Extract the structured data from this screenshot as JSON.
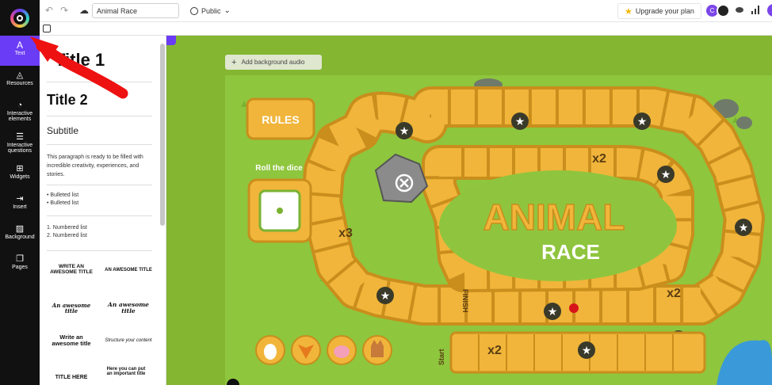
{
  "topbar": {
    "title_value": "Animal Race",
    "visibility": "Public",
    "upgrade_label": "Upgrade your plan",
    "avatar_initial": "C"
  },
  "sidebar": {
    "items": [
      {
        "label": "Text",
        "icon": "text-icon"
      },
      {
        "label": "Resources",
        "icon": "shapes-icon"
      },
      {
        "label": "Interactive elements",
        "icon": "cursor-icon"
      },
      {
        "label": "Interactive questions",
        "icon": "question-list-icon"
      },
      {
        "label": "Widgets",
        "icon": "widget-icon"
      },
      {
        "label": "Insert",
        "icon": "insert-icon"
      },
      {
        "label": "Background",
        "icon": "background-icon"
      },
      {
        "label": "Pages",
        "icon": "pages-icon"
      }
    ]
  },
  "text_panel": {
    "title1": "Title 1",
    "title2": "Title 2",
    "subtitle": "Subtitle",
    "paragraph": "This paragraph is ready to be filled with incredible creativity, experiences, and stories.",
    "bullets": [
      "Bulleted list",
      "Bulleted list"
    ],
    "numbered": [
      "1. Numbered list",
      "2. Numbered list"
    ],
    "tiles": [
      {
        "title": "WRITE AN AWESOME TITLE"
      },
      {
        "title": "AN AWESOME TITLE"
      },
      {
        "title": "An awesome title"
      },
      {
        "title": "An awesome title"
      },
      {
        "title": "Write an awesome title"
      },
      {
        "title": "Structure your content"
      },
      {
        "title": "TITLE HERE"
      },
      {
        "title": "Here you can put an important title"
      }
    ]
  },
  "canvas": {
    "audio_label": "Add background audio",
    "rules_label": "RULES",
    "roll_label": "Roll the dice",
    "title_big": "ANIMAL",
    "title_small": "RACE",
    "finish": "FINISH",
    "start": "Start",
    "x2": "x2",
    "x3": "x3"
  }
}
